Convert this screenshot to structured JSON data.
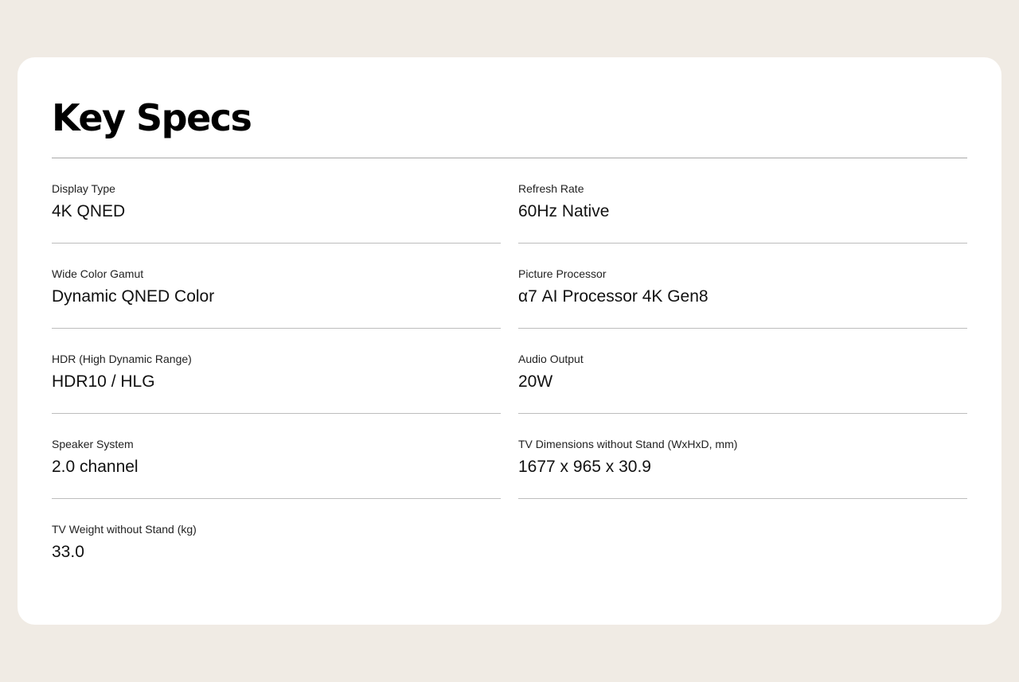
{
  "section": {
    "title": "Key Specs"
  },
  "specs": [
    {
      "label": "Display Type",
      "value": "4K QNED"
    },
    {
      "label": "Refresh Rate",
      "value": "60Hz Native"
    },
    {
      "label": "Wide Color Gamut",
      "value": "Dynamic QNED Color"
    },
    {
      "label": "Picture Processor",
      "value": "α7 AI Processor 4K Gen8"
    },
    {
      "label": "HDR (High Dynamic Range)",
      "value": "HDR10 / HLG"
    },
    {
      "label": "Audio Output",
      "value": "20W"
    },
    {
      "label": "Speaker System",
      "value": "2.0 channel"
    },
    {
      "label": "TV Dimensions without Stand (WxHxD, mm)",
      "value": "1677 x 965 x 30.9"
    },
    {
      "label": "TV Weight without Stand (kg)",
      "value": "33.0"
    }
  ],
  "colors": {
    "page_background": "#f0ebe4",
    "card_background": "#ffffff",
    "divider": "#bdbdbd",
    "text": "#111111"
  }
}
